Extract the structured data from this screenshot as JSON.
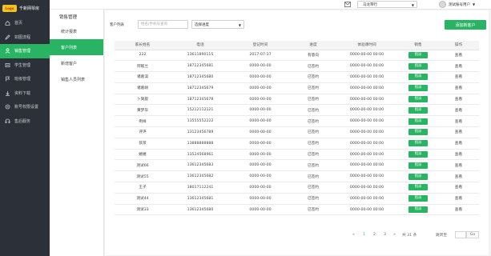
{
  "brand": {
    "logo_text": "Logo",
    "name": "千新网琴房"
  },
  "sidebar": {
    "items": [
      {
        "label": "首页",
        "icon": "home-icon"
      },
      {
        "label": "如图流程",
        "icon": "pencil-icon"
      },
      {
        "label": "销售管理",
        "icon": "user-icon",
        "active": true
      },
      {
        "label": "学生管理",
        "icon": "student-icon"
      },
      {
        "label": "班级管理",
        "icon": "flag-icon"
      },
      {
        "label": "资料下载",
        "icon": "download-icon"
      },
      {
        "label": "账号权限设置",
        "icon": "settings-icon"
      },
      {
        "label": "售后服务",
        "icon": "service-icon"
      }
    ]
  },
  "submenu": {
    "title": "销售管理",
    "items": [
      {
        "label": "统计报表"
      },
      {
        "label": "客户列表",
        "active": true
      },
      {
        "label": "新增客户"
      },
      {
        "label": "销售人员列表"
      }
    ]
  },
  "header": {
    "store_select": "马龙琴行",
    "user_name": "测试账号用户",
    "colors": {
      "accent": "#28b463",
      "sidebar": "#2c3038"
    }
  },
  "filter": {
    "label": "客户列表",
    "search_placeholder": "姓名/手机号查询",
    "status_select": "选择进度",
    "add_button": "添加新客户"
  },
  "table": {
    "headers": [
      "家长姓名",
      "电话",
      "登记时间",
      "进度",
      "体验课时间",
      "销售",
      "操作"
    ],
    "assign_label": "指派",
    "view_label": "查看",
    "rows": [
      [
        "222",
        "13611890115",
        "2017-07-17",
        "有意向",
        "0000-00-00 00:00"
      ],
      [
        "阿敌兰",
        "18712345681",
        "0000-00-00",
        "已签约",
        "0000-00-00 00:00"
      ],
      [
        "诸葛淇",
        "18712345680",
        "0000-00-00",
        "已签约",
        "0000-00-00 00:00"
      ],
      [
        "诸葛峒",
        "18712345679",
        "0000-00-00",
        "已签约",
        "0000-00-00 00:00"
      ],
      [
        "卜旖旎",
        "18712345678",
        "0000-00-00",
        "已签约",
        "0000-00-00 00:00"
      ],
      [
        "黄梦毕",
        "15212112121",
        "0000-00-00",
        "已签约",
        "0000-00-00 00:00"
      ],
      [
        "例样",
        "13555552222",
        "0000-00-00",
        "已签约",
        "0000-00-00 00:00"
      ],
      [
        "评评",
        "13123456789",
        "0000-00-00",
        "已签约",
        "0000-00-00 00:00"
      ],
      [
        "孩孩",
        "13888888888",
        "0000-00-00",
        "已签约",
        "0000-00-00 00:00"
      ],
      [
        "嬉嬉",
        "13524568961",
        "0000-00-00",
        "已签约",
        "0000-00-00 00:00"
      ],
      [
        "测试66",
        "13612345683",
        "0000-00-00",
        "已签约",
        "0000-00-00 00:00"
      ],
      [
        "测试55",
        "13612345682",
        "0000-00-00",
        "已签约",
        "0000-00-00 00:00"
      ],
      [
        "王子",
        "18017112241",
        "0000-00-00",
        "已签约",
        "0000-00-00 00:00"
      ],
      [
        "测试44",
        "13612345681",
        "0000-00-00",
        "已签约",
        "0000-00-00 00:00"
      ],
      [
        "测试33",
        "13612345680",
        "0000-00-00",
        "已签约",
        "0000-00-00 00:00"
      ]
    ]
  },
  "pagination": {
    "prev": "«",
    "pages": [
      "1",
      "2",
      "3"
    ],
    "next": "»",
    "total": "共 31 条",
    "jump_label": "跳转至",
    "go_label": "Go"
  }
}
